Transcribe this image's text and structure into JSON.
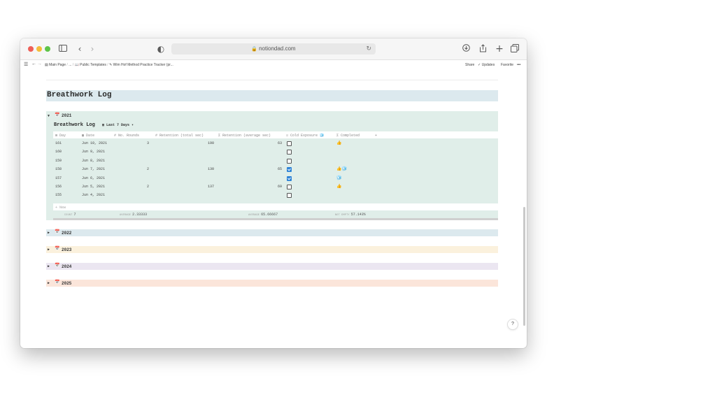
{
  "browser": {
    "url": "notiondad.com",
    "traffic_lights": [
      "#ee5f57",
      "#f4bd3b",
      "#5ec448"
    ]
  },
  "notion_bar": {
    "breadcrumbs": [
      "Main Page",
      "/",
      "...",
      "/",
      "Public Templates",
      "/",
      "Wim Hof Method Practice Tracker (pr..."
    ],
    "share": "Share",
    "updates": "Updates",
    "favorite": "Favorite",
    "more": "•••"
  },
  "page": {
    "title": "Breathwork Log"
  },
  "groups": [
    {
      "year": "2021",
      "expanded": true,
      "color": "#e0eee9"
    },
    {
      "year": "2022",
      "expanded": false,
      "color": "#dce9ee"
    },
    {
      "year": "2023",
      "expanded": false,
      "color": "#fbf1dd"
    },
    {
      "year": "2024",
      "expanded": false,
      "color": "#ebe6f1"
    },
    {
      "year": "2025",
      "expanded": false,
      "color": "#fbe5da"
    }
  ],
  "database": {
    "title": "Breathwork Log",
    "view": "Last 7 Days",
    "columns": [
      "Day",
      "Date",
      "No. Rounds",
      "Retention (total sec)",
      "Σ Retention (average sec)",
      "Cold Exposure",
      "Σ Completed",
      "+"
    ],
    "rows": [
      {
        "day": "161",
        "date": "Jun 10, 2021",
        "rounds": "3",
        "retention_total": "190",
        "retention_avg": "63",
        "cold": false,
        "completed": "👍"
      },
      {
        "day": "160",
        "date": "Jun 9, 2021",
        "rounds": "",
        "retention_total": "",
        "retention_avg": "",
        "cold": false,
        "completed": ""
      },
      {
        "day": "159",
        "date": "Jun 8, 2021",
        "rounds": "",
        "retention_total": "",
        "retention_avg": "",
        "cold": false,
        "completed": ""
      },
      {
        "day": "158",
        "date": "Jun 7, 2021",
        "rounds": "2",
        "retention_total": "130",
        "retention_avg": "65",
        "cold": true,
        "completed": "👍🧊"
      },
      {
        "day": "157",
        "date": "Jun 6, 2021",
        "rounds": "",
        "retention_total": "",
        "retention_avg": "",
        "cold": true,
        "completed": "🧊"
      },
      {
        "day": "156",
        "date": "Jun 5, 2021",
        "rounds": "2",
        "retention_total": "137",
        "retention_avg": "69",
        "cold": false,
        "completed": "👍"
      },
      {
        "day": "155",
        "date": "Jun 4, 2021",
        "rounds": "",
        "retention_total": "",
        "retention_avg": "",
        "cold": false,
        "completed": ""
      }
    ],
    "new_label": "+ New",
    "calculations": {
      "count_label": "COUNT",
      "count": "7",
      "rounds_label": "AVERAGE",
      "rounds_avg": "2.33333",
      "retention_label": "AVERAGE",
      "retention_avg": "65.66667",
      "cold_label": "NOT EMPTY",
      "cold_pct": "57.143%"
    }
  },
  "help_label": "?"
}
